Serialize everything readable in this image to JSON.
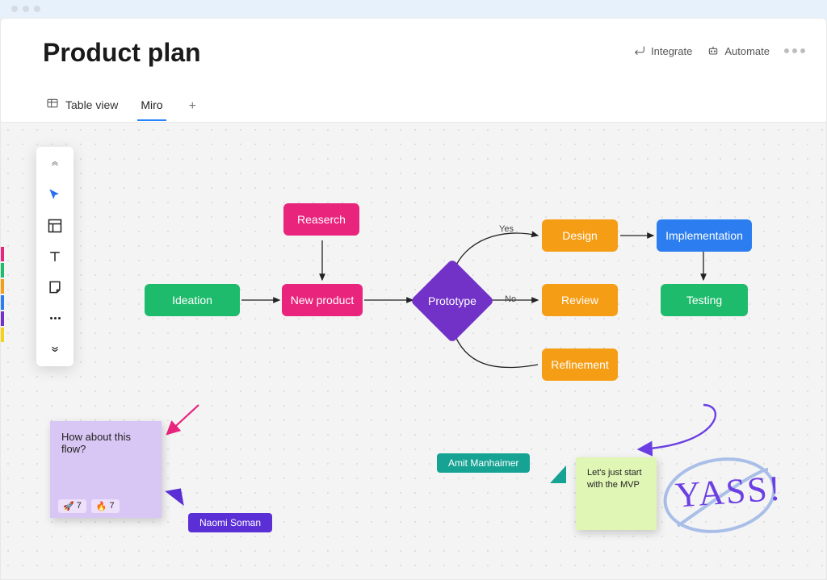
{
  "header": {
    "title": "Product plan",
    "actions": {
      "integrate": "Integrate",
      "automate": "Automate"
    }
  },
  "tabs": {
    "table_view": "Table view",
    "miro": "Miro"
  },
  "nodes": {
    "ideation": "Ideation",
    "research": "Reaserch",
    "new_product": "New product",
    "prototype": "Prototype",
    "design": "Design",
    "review": "Review",
    "refinement": "Refinement",
    "implementation": "Implementation",
    "testing": "Testing"
  },
  "edges": {
    "yes": "Yes",
    "no": "No"
  },
  "stickies": {
    "purple_text": "How about this flow?",
    "lime_text": "Let's just start with the MVP",
    "reactions": {
      "rocket_count": "7",
      "fire_count": "7",
      "rocket_emoji": "🚀",
      "fire_emoji": "🔥"
    }
  },
  "users": {
    "amit": "Amit Manhaimer",
    "naomi": "Naomi Soman"
  },
  "handwriting": {
    "yass": "YASS!"
  }
}
